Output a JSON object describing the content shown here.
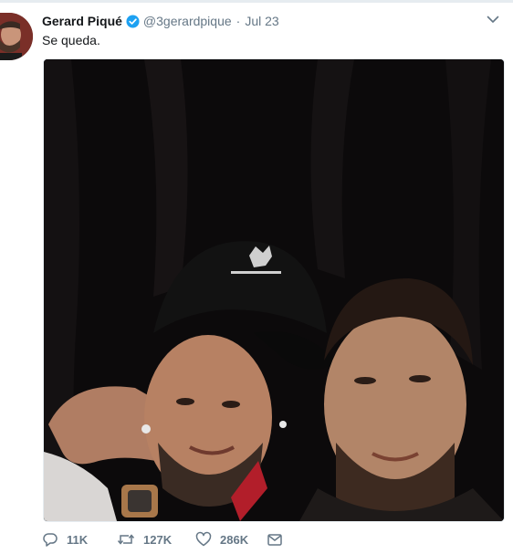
{
  "tweet": {
    "author_name": "Gerard Piqué",
    "handle": "@3gerardpique",
    "separator": "·",
    "date": "Jul 23",
    "text": "Se queda."
  },
  "actions": {
    "replies": "11K",
    "retweets": "127K",
    "likes": "286K"
  },
  "icons": {
    "verified": "verified-badge-icon",
    "caret": "chevron-down-icon",
    "reply": "reply-icon",
    "retweet": "retweet-icon",
    "like": "heart-icon",
    "dm": "envelope-icon"
  },
  "colors": {
    "text_primary": "#14171a",
    "text_secondary": "#657786",
    "verified_blue": "#1da1f2",
    "divider": "#e6ecf0"
  }
}
